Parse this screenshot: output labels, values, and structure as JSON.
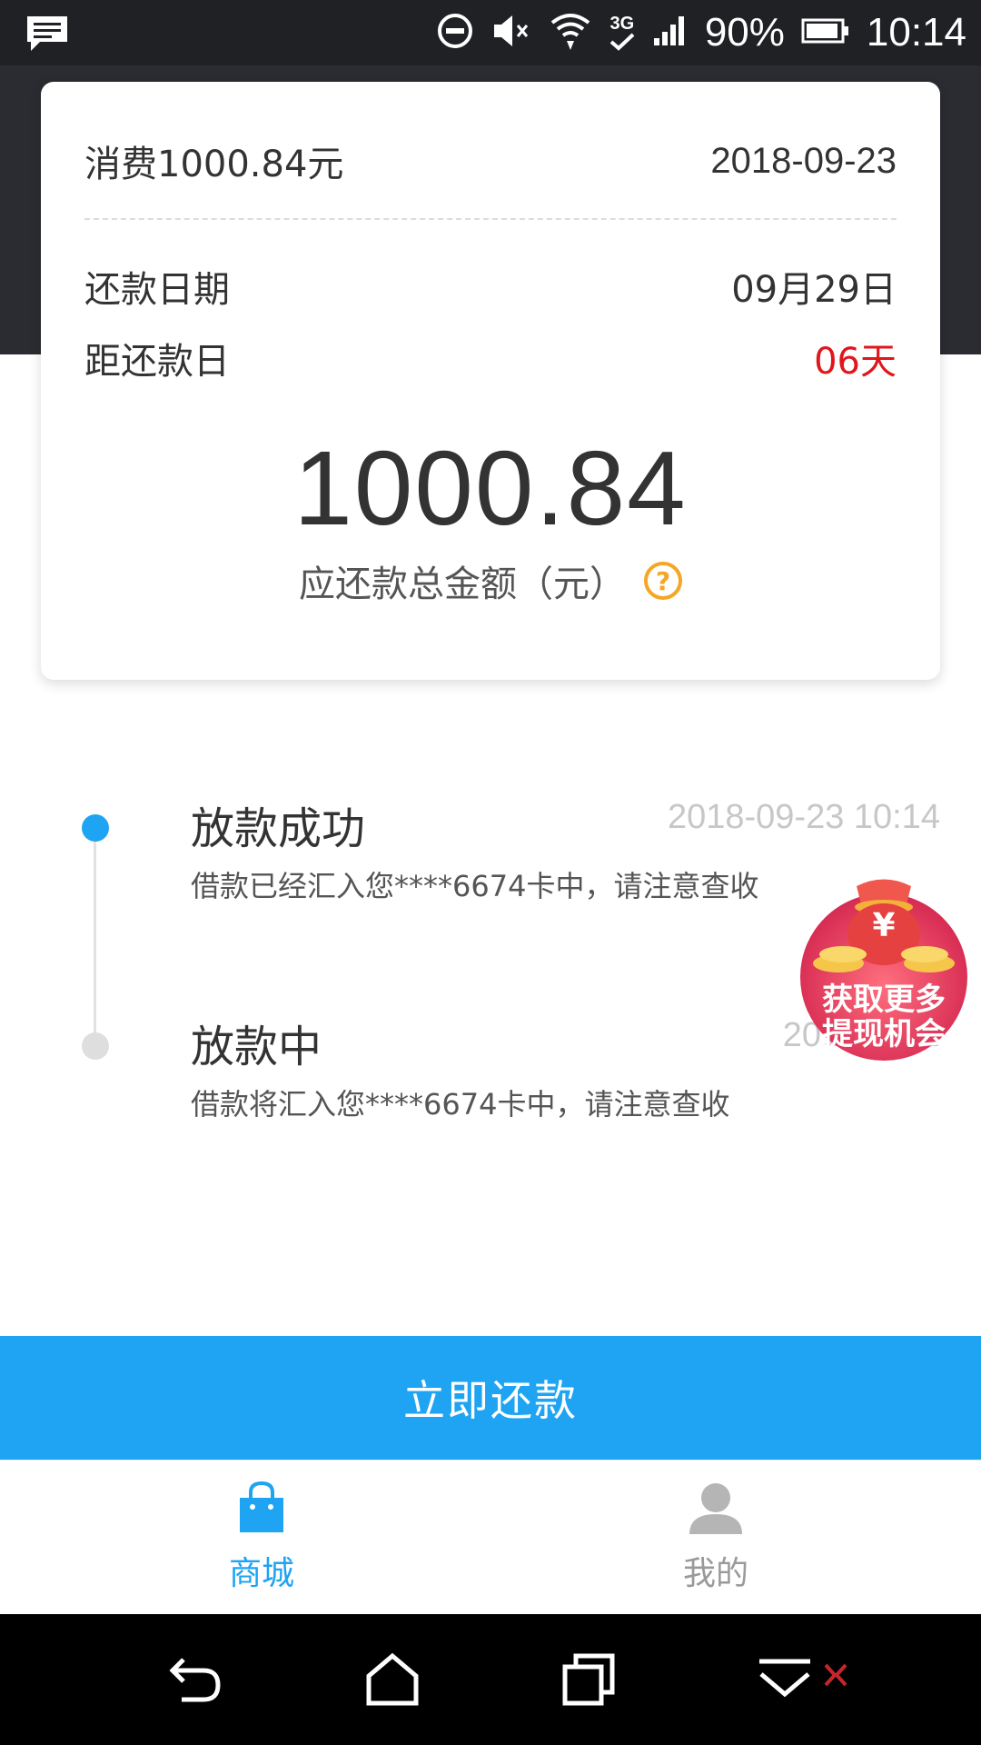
{
  "status_bar": {
    "battery_percent": "90%",
    "time": "10:14",
    "network_type": "3G",
    "icons": [
      "message-icon",
      "do-not-disturb-icon",
      "mute-icon",
      "wifi-icon",
      "network-3g-icon",
      "signal-icon",
      "battery-icon"
    ]
  },
  "summary_card": {
    "consumption_label": "消费1000.84元",
    "consumption_date": "2018-09-23",
    "repay_date_label": "还款日期",
    "repay_date_value": "09月29日",
    "days_left_label": "距还款日",
    "days_left_value": "06天",
    "total_amount": "1000.84",
    "total_amount_label": "应还款总金额（元）",
    "help_icon": "?"
  },
  "timeline": [
    {
      "title": "放款成功",
      "time": "2018-09-23 10:14",
      "description": "借款已经汇入您****6674卡中，请注意查收",
      "active": true
    },
    {
      "title": "放款中",
      "time": "2018-09-2",
      "description": "借款将汇入您****6674卡中，请注意查收",
      "active": false
    }
  ],
  "promo": {
    "line1": "获取更多",
    "line2": "提现机会",
    "symbol": "¥"
  },
  "repay_button": {
    "label": "立即还款"
  },
  "tabbar": {
    "tabs": [
      {
        "label": "商城",
        "icon": "shopping-bag-icon",
        "active": true
      },
      {
        "label": "我的",
        "icon": "user-icon",
        "active": false
      }
    ]
  },
  "colors": {
    "accent": "#1ea4f3",
    "warning": "#e0161c",
    "help": "#f5a623",
    "header_dark": "#2a2c31"
  }
}
